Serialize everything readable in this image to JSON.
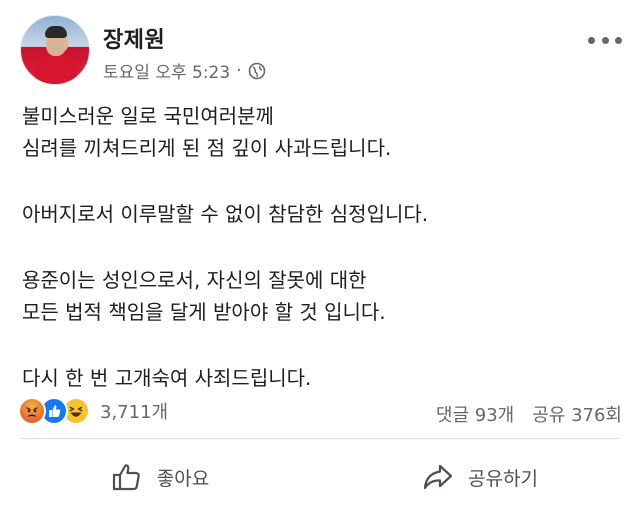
{
  "post": {
    "author": "장제원",
    "timestamp": "토요일 오후 5:23",
    "separator": "·",
    "privacy_icon": "globe-icon",
    "paragraphs": [
      [
        "불미스러운 일로 국민여러분께",
        "심려를 끼쳐드리게 된 점 깊이 사과드립니다."
      ],
      [
        "아버지로서 이루말할 수 없이 참담한 심정입니다."
      ],
      [
        "용준이는 성인으로서, 자신의 잘못에 대한",
        "모든 법적 책임을 달게 받아야 할 것 입니다."
      ],
      [
        "다시 한 번 고개숙여 사죄드립니다."
      ]
    ]
  },
  "stats": {
    "reaction_icons": [
      "angry-reaction-icon",
      "like-reaction-icon",
      "haha-reaction-icon"
    ],
    "reaction_count": "3,711개",
    "comments": "댓글 93개",
    "shares": "공유 376회"
  },
  "actions": {
    "like_label": "좋아요",
    "share_label": "공유하기"
  },
  "colors": {
    "like_blue": "#1877f2",
    "text_secondary": "#65676b",
    "text_primary": "#1c1e21"
  }
}
